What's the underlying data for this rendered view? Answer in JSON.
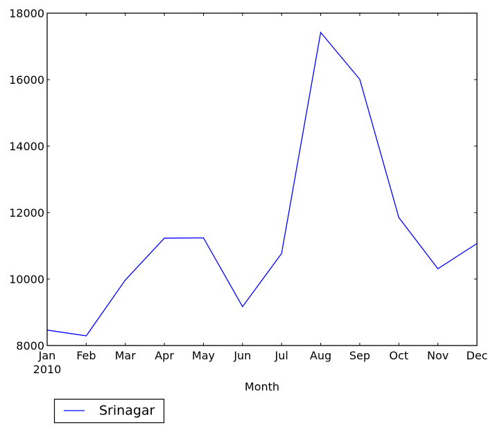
{
  "chart_data": {
    "type": "line",
    "title": "",
    "xlabel": "Month",
    "ylabel": "",
    "categories": [
      "Jan",
      "Feb",
      "Mar",
      "Apr",
      "May",
      "Jun",
      "Jul",
      "Aug",
      "Sep",
      "Oct",
      "Nov",
      "Dec"
    ],
    "x_sublabel": "2010",
    "ylim": [
      8000,
      18000
    ],
    "yticks": [
      8000,
      10000,
      12000,
      14000,
      16000,
      18000
    ],
    "ytick_labels": [
      "8000",
      "10000",
      "12000",
      "14000",
      "16000",
      "18000"
    ],
    "grid": false,
    "legend_position": "below-left",
    "series": [
      {
        "name": "Srinagar",
        "color": "#0000ff",
        "values": [
          8465,
          8290,
          9970,
          11230,
          11240,
          9170,
          10770,
          17420,
          16010,
          11850,
          10310,
          11070
        ]
      }
    ]
  }
}
